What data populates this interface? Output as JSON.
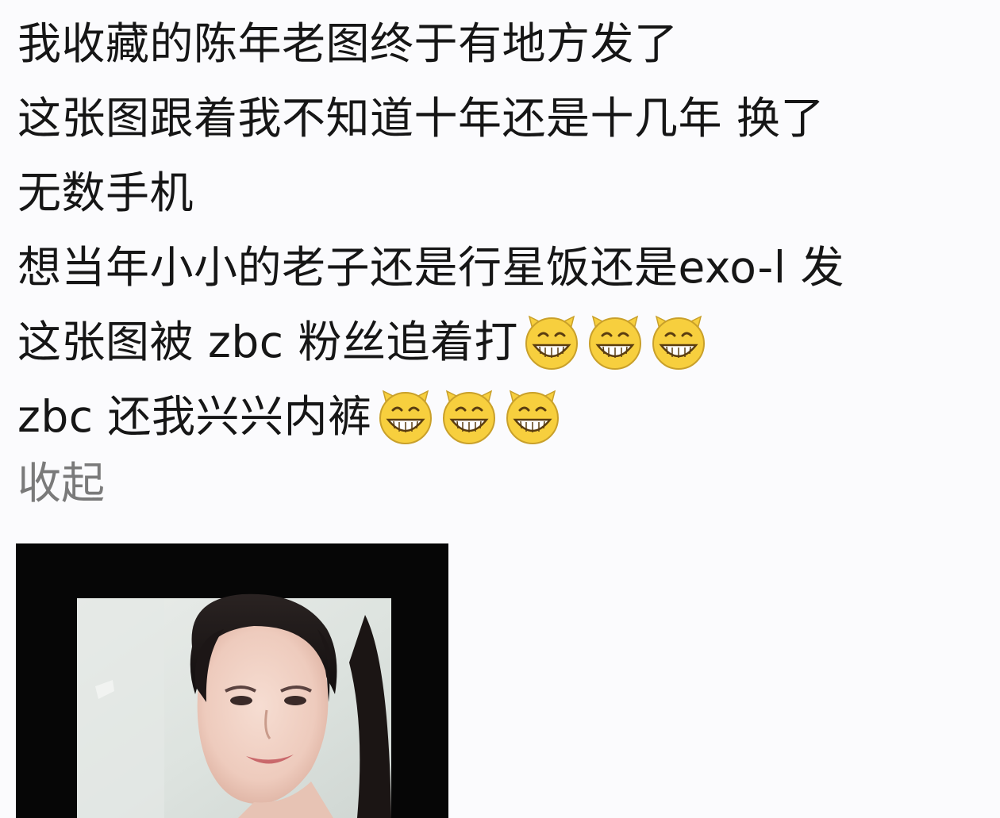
{
  "post": {
    "lines": [
      "我收藏的陈年老图终于有地方发了",
      "这张图跟着我不知道十年还是十几年 换了",
      "无数手机",
      "想当年小小的老子还是行星饭还是exo-l 发",
      "这张图被 zbc 粉丝追着打",
      "zbc 还我兴兴内裤"
    ],
    "emoji_name": "grin-emoji",
    "collapse_label": "收起"
  },
  "photo": {
    "alt": "portrait-photo"
  },
  "colors": {
    "background": "#fbfbfd",
    "text": "#161616",
    "collapse": "#7a7a7a",
    "emoji_face": "#f7cf3e"
  }
}
